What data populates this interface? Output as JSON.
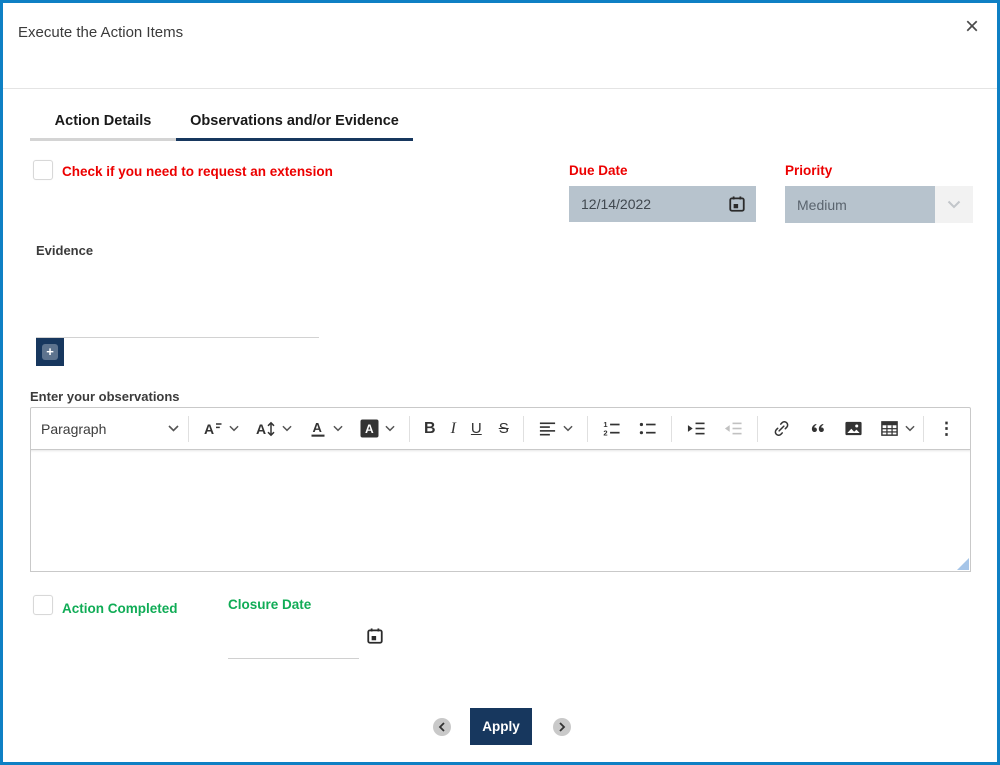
{
  "modal": {
    "title": "Execute the Action Items",
    "close_glyph": "×"
  },
  "tabs": {
    "details": {
      "label": "Action Details",
      "active": false
    },
    "observations": {
      "label": "Observations and/or Evidence",
      "active": true
    }
  },
  "fields": {
    "extension": {
      "label": "Check if you need to request an extension",
      "checked": false
    },
    "due_date": {
      "label": "Due Date",
      "value": "12/14/2022",
      "disabled": true
    },
    "priority": {
      "label": "Priority",
      "value": "Medium",
      "disabled": true
    },
    "evidence": {
      "label": "Evidence"
    },
    "observations": {
      "label": "Enter your observations",
      "value": ""
    },
    "action_completed": {
      "label": "Action Completed",
      "checked": false
    },
    "closure_date": {
      "label": "Closure Date",
      "value": ""
    }
  },
  "editor_toolbar": {
    "paragraph_label": "Paragraph",
    "bold_glyph": "B",
    "italic_glyph": "I",
    "underline_glyph": "U",
    "strikethrough_glyph": "S",
    "more_glyph": "⋮",
    "plus_glyph": "+",
    "buttons": [
      "paragraph-style",
      "font-family",
      "font-size",
      "font-color",
      "font-background-color",
      "bold",
      "italic",
      "underline",
      "strikethrough",
      "text-alignment",
      "numbered-list",
      "bulleted-list",
      "indent",
      "outdent",
      "link",
      "block-quote",
      "insert-image",
      "insert-table",
      "more-options"
    ]
  },
  "footer": {
    "apply_label": "Apply"
  },
  "colors": {
    "modal_border_blue": "#0e80c4",
    "accent_navy": "#17375e",
    "required_red": "#ec0000",
    "completed_green": "#10ac56",
    "disabled_field_bg": "#b7c3cd",
    "resize_handle_blue": "#a6c5e8"
  }
}
